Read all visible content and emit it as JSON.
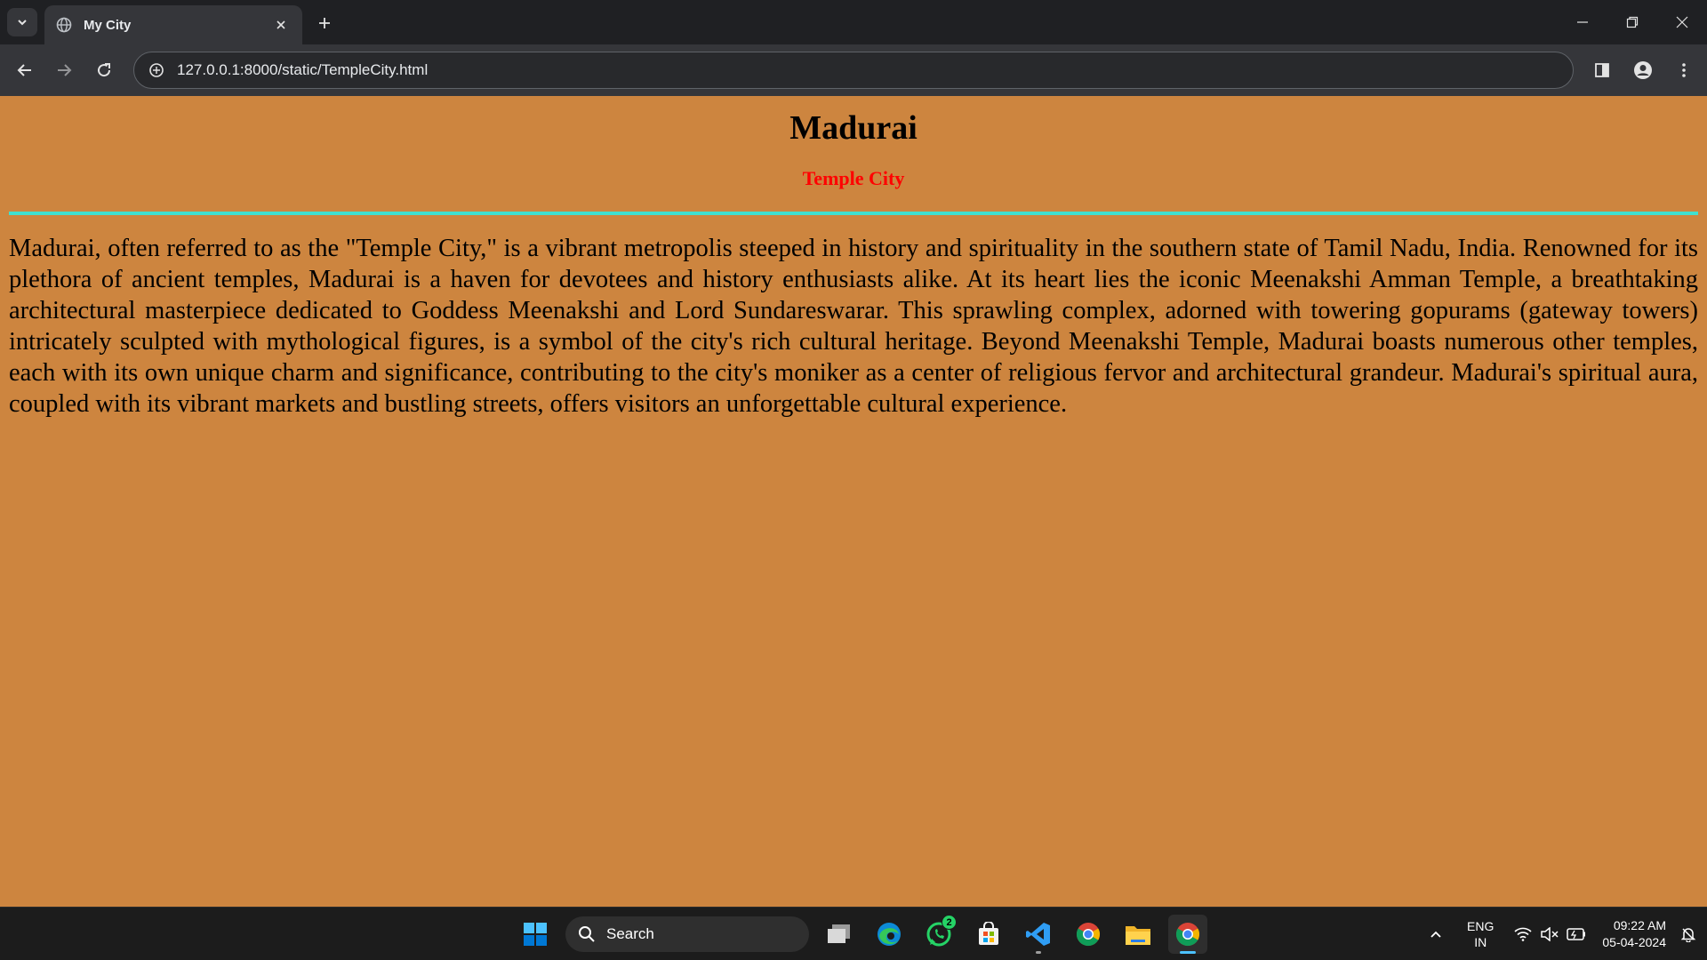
{
  "browser": {
    "tab_title": "My City",
    "url": "127.0.0.1:8000/static/TempleCity.html"
  },
  "page": {
    "title": "Madurai",
    "subtitle": "Temple City",
    "paragraph": "Madurai, often referred to as the \"Temple City,\" is a vibrant metropolis steeped in history and spirituality in the southern state of Tamil Nadu, India. Renowned for its plethora of ancient temples, Madurai is a haven for devotees and history enthusiasts alike. At its heart lies the iconic Meenakshi Amman Temple, a breathtaking architectural masterpiece dedicated to Goddess Meenakshi and Lord Sundareswarar. This sprawling complex, adorned with towering gopurams (gateway towers) intricately sculpted with mythological figures, is a symbol of the city's rich cultural heritage. Beyond Meenakshi Temple, Madurai boasts numerous other temples, each with its own unique charm and significance, contributing to the city's moniker as a center of religious fervor and architectural grandeur. Madurai's spiritual aura, coupled with its vibrant markets and bustling streets, offers visitors an unforgettable cultural experience.",
    "colors": {
      "background": "#cd853f",
      "subtitle": "#ff0000",
      "rule": "#40e0d0"
    }
  },
  "taskbar": {
    "search_label": "Search",
    "whatsapp_badge": "2",
    "apps": [
      "windows-start-icon",
      "task-view-icon",
      "edge-icon",
      "whatsapp-icon",
      "microsoft-store-icon",
      "vscode-icon",
      "chrome-icon",
      "file-explorer-icon",
      "chrome-active-icon"
    ],
    "lang_line1": "ENG",
    "lang_line2": "IN",
    "time": "09:22 AM",
    "date": "05-04-2024"
  }
}
